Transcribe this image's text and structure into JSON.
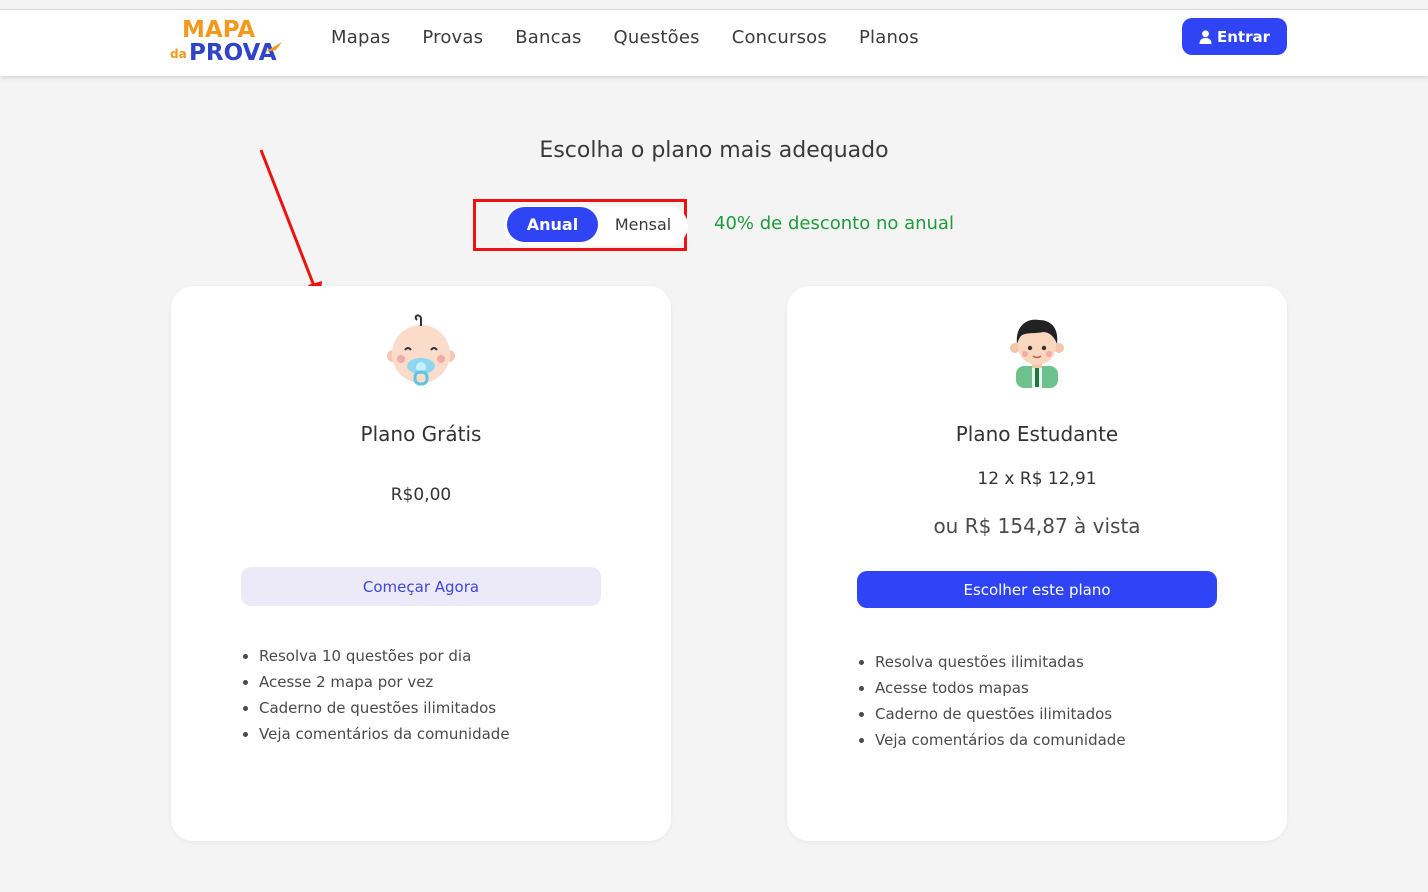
{
  "header": {
    "logo_top": "MAPA",
    "logo_small": "da",
    "logo_bottom": "PROVA",
    "nav": [
      "Mapas",
      "Provas",
      "Bancas",
      "Questões",
      "Concursos",
      "Planos"
    ],
    "login_label": "Entrar",
    "login_icon": "user-icon"
  },
  "page": {
    "title": "Escolha o plano mais adequado",
    "toggle": {
      "annual": "Anual",
      "monthly": "Mensal",
      "selected": "Anual"
    },
    "discount": "40% de desconto no anual"
  },
  "plans": [
    {
      "title": "Plano Grátis",
      "avatar": "baby-avatar-icon",
      "price": "R$0,00",
      "button": "Começar Agora",
      "features": [
        "Resolva 10 questões por dia",
        "Acesse 2 mapa por vez",
        "Caderno de questões ilimitados",
        "Veja comentários da comunidade"
      ]
    },
    {
      "title": "Plano Estudante",
      "avatar": "student-avatar-icon",
      "price": "12 x R$ 12,91",
      "price_full": "ou R$ 154,87 à vista",
      "button": "Escolher este plano",
      "features": [
        "Resolva questões ilimitadas",
        "Acesse todos mapas",
        "Caderno de questões ilimitados",
        "Veja comentários da comunidade"
      ]
    }
  ],
  "colors": {
    "primary": "#2f45f5",
    "discount": "#1f9b3a",
    "highlight": "#ee1111",
    "logo_orange": "#f39a1e",
    "logo_blue": "#2f45c5"
  }
}
